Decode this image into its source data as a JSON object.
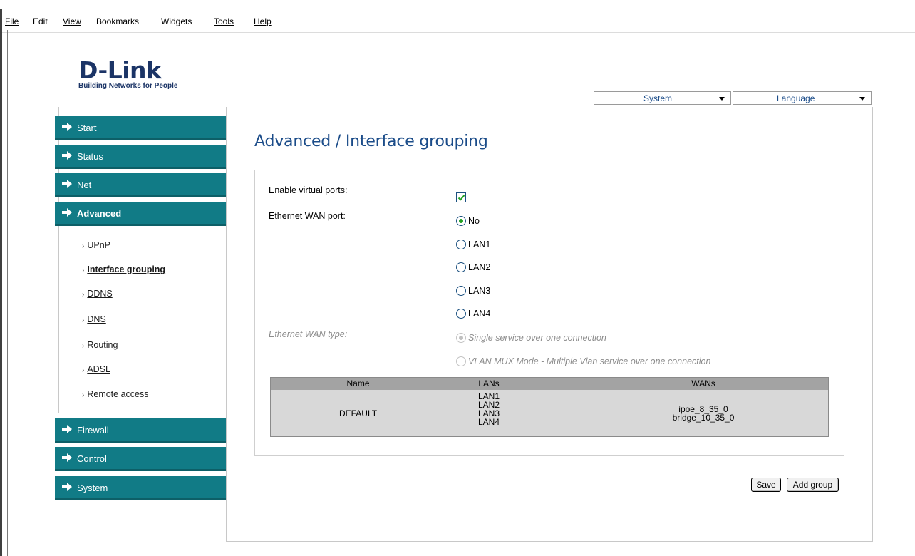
{
  "menubar": {
    "items": [
      {
        "label": "File"
      },
      {
        "label": "Edit"
      },
      {
        "label": "View"
      },
      {
        "label": "Bookmarks"
      },
      {
        "label": "Widgets"
      },
      {
        "label": "Tools"
      },
      {
        "label": "Help"
      }
    ]
  },
  "logo": {
    "brand": "D-Link",
    "tagline": "Building Networks for People"
  },
  "top_dropdowns": {
    "system": {
      "value": "System"
    },
    "language": {
      "value": "Language"
    }
  },
  "sidebar": {
    "groups": [
      {
        "label": "Start"
      },
      {
        "label": "Status"
      },
      {
        "label": "Net"
      },
      {
        "label": "Advanced"
      },
      {
        "label": "Firewall"
      },
      {
        "label": "Control"
      },
      {
        "label": "System"
      }
    ],
    "advanced_items": [
      {
        "label": "UPnP"
      },
      {
        "label": "Interface grouping"
      },
      {
        "label": "DDNS"
      },
      {
        "label": "DNS"
      },
      {
        "label": "Routing"
      },
      {
        "label": "ADSL"
      },
      {
        "label": "Remote access"
      }
    ]
  },
  "page": {
    "title": "Advanced /  Interface grouping"
  },
  "form": {
    "enable_virtual_ports_label": "Enable virtual ports:",
    "enable_virtual_ports_checked": true,
    "ethernet_wan_port_label": "Ethernet WAN port:",
    "ethernet_wan_port_options": [
      {
        "label": "No",
        "selected": true
      },
      {
        "label": "LAN1",
        "selected": false
      },
      {
        "label": "LAN2",
        "selected": false
      },
      {
        "label": "LAN3",
        "selected": false
      },
      {
        "label": "LAN4",
        "selected": false
      }
    ],
    "ethernet_wan_type_label": "Ethernet WAN type:",
    "ethernet_wan_type_options": [
      {
        "label": "Single service over one connection",
        "selected": true
      },
      {
        "label": "VLAN MUX Mode - Multiple Vlan service over one connection",
        "selected": false
      }
    ]
  },
  "groups_table": {
    "headers": [
      "Name",
      "LANs",
      "WANs"
    ],
    "rows": [
      {
        "name": "DEFAULT",
        "lans": [
          "LAN1",
          "LAN2",
          "LAN3",
          "LAN4"
        ],
        "wans": [
          "ipoe_8_35_0",
          "bridge_10_35_0"
        ]
      }
    ]
  },
  "actions": {
    "save_label": "Save",
    "add_group_label": "Add group"
  },
  "colors": {
    "nav_bg": "#117b86",
    "title_blue": "#1b4c89",
    "brand_navy": "#1b3466",
    "radio_green": "#22a122"
  }
}
